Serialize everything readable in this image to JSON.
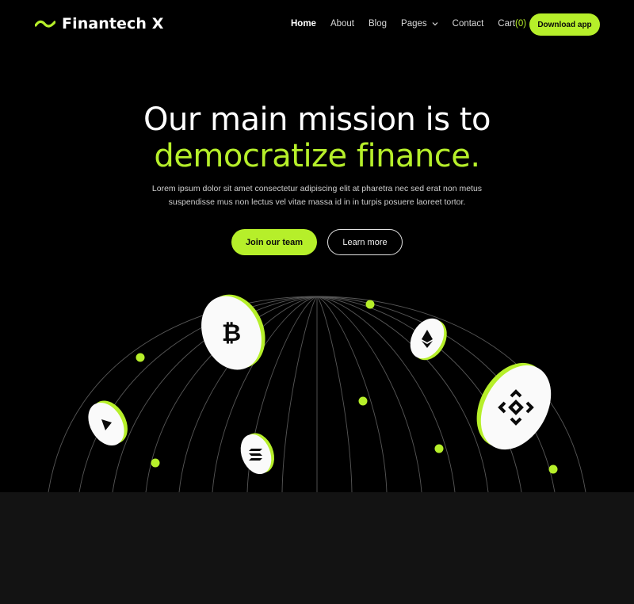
{
  "brand": {
    "name": "Finantech X",
    "accent": "#b6ef2a",
    "logo_icon": "wave-logo-icon"
  },
  "nav": {
    "items": [
      {
        "label": "Home",
        "active": true
      },
      {
        "label": "About"
      },
      {
        "label": "Blog"
      },
      {
        "label": "Pages",
        "icon": "chevron-down-icon"
      },
      {
        "label": "Contact"
      }
    ],
    "cart_label": "Cart",
    "cart_count": "(0)",
    "download_label": "Download app"
  },
  "hero": {
    "title_line1": "Our  main mission is to",
    "title_line2": "democratize finance.",
    "subtitle": "Lorem ipsum dolor sit amet consectetur adipiscing elit at pharetra nec sed erat non metus suspendisse mus non lectus vel vitae massa id in in turpis posuere laoreet tortor.",
    "primary_button": "Join our team",
    "secondary_button": "Learn more"
  },
  "globe": {
    "coins": [
      "bitcoin-icon",
      "ethereum-icon",
      "binance-icon",
      "tron-icon",
      "solana-icon"
    ],
    "line_color": "#5a5a5a"
  }
}
